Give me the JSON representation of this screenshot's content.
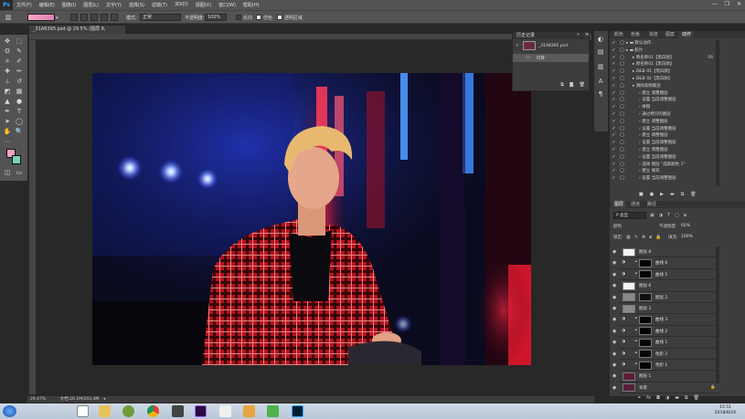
{
  "app": {
    "logo": "Ps"
  },
  "menu": [
    "文件(F)",
    "编辑(E)",
    "图像(I)",
    "图层(L)",
    "文字(Y)",
    "选择(S)",
    "滤镜(T)",
    "3D(D)",
    "视图(V)",
    "窗口(W)",
    "帮助(H)"
  ],
  "window_controls": {
    "minimize": "—",
    "restore": "❐",
    "close": "✕"
  },
  "options": {
    "mode_label": "模式:",
    "mode_value": "正常",
    "opacity_label": "不透明度:",
    "opacity_value": "100%",
    "reverse": "反向",
    "dither": "仿色",
    "transparency": "透明区域"
  },
  "document": {
    "tab": "_31A8395.psd @ 29.5% (图层 8, RGB/8*) *",
    "close": "×"
  },
  "history": {
    "title": "历史记录",
    "snapshot": "_31A8395.psd",
    "items": [
      "打开"
    ]
  },
  "right_tabs": [
    "颜色",
    "色板",
    "渐变",
    "图案",
    "动作"
  ],
  "actions": [
    {
      "label": "默认动作",
      "indent": 0
    },
    {
      "label": "胶片",
      "indent": 0
    },
    {
      "label": "原名称01【黑白款】",
      "indent": 1,
      "key": "F6"
    },
    {
      "label": "原名称01【黑白款】",
      "indent": 1
    },
    {
      "label": "D&B 01【黑白款】",
      "indent": 1
    },
    {
      "label": "D&B 02【黑白款】",
      "indent": 1
    },
    {
      "label": "清除高频痕迹",
      "indent": 1
    },
    {
      "label": "建立 调整图层",
      "indent": 2
    },
    {
      "label": "设置 当前调整图层",
      "indent": 2
    },
    {
      "label": "拼稿",
      "indent": 2
    },
    {
      "label": "通过拷贝的图层",
      "indent": 2
    },
    {
      "label": "建立 调整图层",
      "indent": 2
    },
    {
      "label": "设置 当前调整图层",
      "indent": 2
    },
    {
      "label": "建立 调整图层",
      "indent": 2
    },
    {
      "label": "设置 当前调整图层",
      "indent": 2
    },
    {
      "label": "建立 调整图层",
      "indent": 2
    },
    {
      "label": "设置 当前调整图层",
      "indent": 2
    },
    {
      "label": "选择 图层 \"选取颜色 1\"",
      "indent": 2
    },
    {
      "label": "建立 填充",
      "indent": 2
    },
    {
      "label": "设置 当前调整图层",
      "indent": 2
    }
  ],
  "layers_tabs": [
    "图层",
    "通道",
    "路径"
  ],
  "layers_panel": {
    "filter": "P 类型",
    "blend": "颜色",
    "opacity_label": "不透明度:",
    "opacity": "60%",
    "lock_label": "锁定:",
    "fill_label": "填充:",
    "fill": "100%"
  },
  "layers": [
    {
      "name": "图层 8",
      "thumb": "white",
      "mask": false
    },
    {
      "name": "曲线 6",
      "thumb": "adj",
      "mask": true
    },
    {
      "name": "曲线 5",
      "thumb": "adj",
      "mask": true
    },
    {
      "name": "图层 6",
      "thumb": "white",
      "mask": false
    },
    {
      "name": "图层 2",
      "thumb": "gray",
      "mask": true
    },
    {
      "name": "图层 3",
      "thumb": "gray",
      "mask": false
    },
    {
      "name": "曲线 3",
      "thumb": "adj",
      "mask": true
    },
    {
      "name": "曲线 2",
      "thumb": "adj",
      "mask": true
    },
    {
      "name": "曲线 1",
      "thumb": "adj",
      "mask": true
    },
    {
      "name": "色阶 2",
      "thumb": "adj",
      "mask": true
    },
    {
      "name": "色阶 1",
      "thumb": "adj",
      "mask": true
    },
    {
      "name": "图层 1",
      "thumb": "photo",
      "mask": false
    },
    {
      "name": "背景",
      "thumb": "photo",
      "mask": false
    }
  ],
  "status": {
    "zoom": "29.47%",
    "doc": "文档:26.1M/203.4M"
  },
  "clock": {
    "time": "15:51",
    "date": "2018/8/24"
  },
  "colors": {
    "foreground": "#f3a0c6",
    "background": "#78d2b4",
    "accent": "#31a8ff"
  }
}
